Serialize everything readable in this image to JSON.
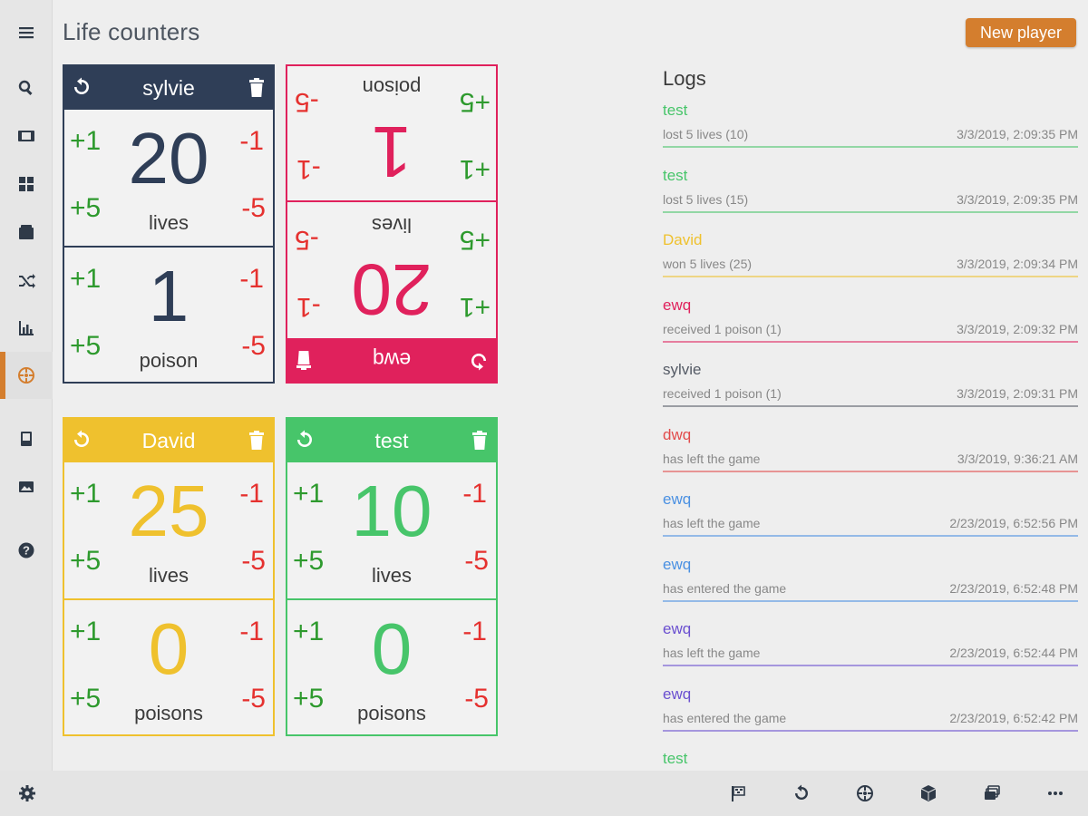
{
  "app": {
    "title": "Life counters"
  },
  "header": {
    "new_player_label": "New player",
    "accent": "#d47e2e"
  },
  "sidebar": {
    "items": [
      {
        "icon": "menu-icon"
      },
      {
        "icon": "search-icon"
      },
      {
        "icon": "film-icon"
      },
      {
        "icon": "grid-icon"
      },
      {
        "icon": "box-icon"
      },
      {
        "icon": "shuffle-icon"
      },
      {
        "icon": "chart-icon"
      },
      {
        "icon": "dial-icon",
        "active": true
      },
      {
        "icon": "book-icon"
      },
      {
        "icon": "image-icon"
      },
      {
        "icon": "help-icon"
      }
    ]
  },
  "bottombar": {
    "icons": [
      "gear-icon",
      "flag-icon",
      "undo-icon",
      "dial-icon",
      "dice-icon",
      "cards-icon",
      "more-icon"
    ]
  },
  "players": [
    {
      "name": "sylvie",
      "color": "#2f3e57",
      "flipped": false,
      "counters": [
        {
          "value": "20",
          "label": "lives"
        },
        {
          "value": "1",
          "label": "poison"
        }
      ],
      "buttons": {
        "p1": "+1",
        "p5": "+5",
        "m1": "-1",
        "m5": "-5"
      }
    },
    {
      "name": "ewq",
      "color": "#e0215c",
      "flipped": true,
      "counters": [
        {
          "value": "20",
          "label": "lives"
        },
        {
          "value": "1",
          "label": "poison"
        }
      ],
      "buttons": {
        "p1": "+1",
        "p5": "+5",
        "m1": "-1",
        "m5": "-5"
      }
    },
    {
      "name": "David",
      "color": "#efc12e",
      "flipped": false,
      "counters": [
        {
          "value": "25",
          "label": "lives"
        },
        {
          "value": "0",
          "label": "poisons"
        }
      ],
      "buttons": {
        "p1": "+1",
        "p5": "+5",
        "m1": "-1",
        "m5": "-5"
      }
    },
    {
      "name": "test",
      "color": "#47c56a",
      "flipped": false,
      "counters": [
        {
          "value": "10",
          "label": "lives"
        },
        {
          "value": "0",
          "label": "poisons"
        }
      ],
      "buttons": {
        "p1": "+1",
        "p5": "+5",
        "m1": "-1",
        "m5": "-5"
      }
    }
  ],
  "logs": {
    "title": "Logs",
    "entries": [
      {
        "who": "test",
        "what": "lost 5 lives (10)",
        "when": "3/3/2019, 2:09:35 PM",
        "color": "#47c56a"
      },
      {
        "who": "test",
        "what": "lost 5 lives (15)",
        "when": "3/3/2019, 2:09:35 PM",
        "color": "#47c56a"
      },
      {
        "who": "David",
        "what": "won 5 lives (25)",
        "when": "3/3/2019, 2:09:34 PM",
        "color": "#efc12e"
      },
      {
        "who": "ewq",
        "what": "received 1 poison (1)",
        "when": "3/3/2019, 2:09:32 PM",
        "color": "#e0215c"
      },
      {
        "who": "sylvie",
        "what": "received 1 poison (1)",
        "when": "3/3/2019, 2:09:31 PM",
        "color": "#555b66"
      },
      {
        "who": "dwq",
        "what": "has left the game",
        "when": "3/3/2019, 9:36:21 AM",
        "color": "#e24b4b"
      },
      {
        "who": "ewq",
        "what": "has left the game",
        "when": "2/23/2019, 6:52:56 PM",
        "color": "#4a90e2"
      },
      {
        "who": "ewq",
        "what": "has entered the game",
        "when": "2/23/2019, 6:52:48 PM",
        "color": "#4a90e2"
      },
      {
        "who": "ewq",
        "what": "has left the game",
        "when": "2/23/2019, 6:52:44 PM",
        "color": "#6a4fd0"
      },
      {
        "who": "ewq",
        "what": "has entered the game",
        "when": "2/23/2019, 6:52:42 PM",
        "color": "#6a4fd0"
      },
      {
        "who": "test",
        "what": "",
        "when": "",
        "color": "#47c56a"
      }
    ]
  }
}
